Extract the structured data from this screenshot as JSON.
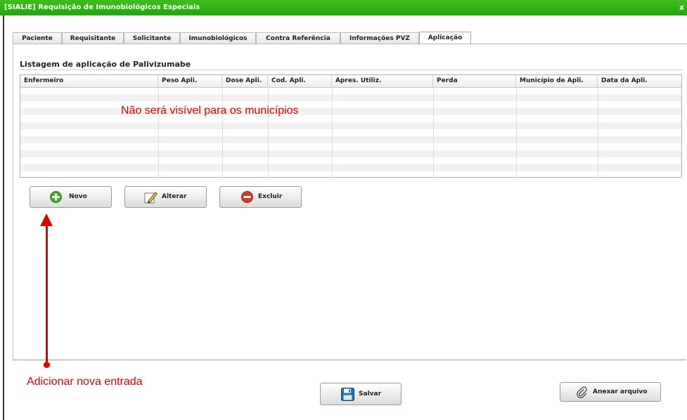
{
  "window": {
    "title": "[SIALIE] Requisição de Imunobiológicos Especiais",
    "close_symbol": "x"
  },
  "tabs": [
    {
      "label": "Paciente",
      "active": false
    },
    {
      "label": "Requisitante",
      "active": false
    },
    {
      "label": "Solicitante",
      "active": false
    },
    {
      "label": "Imunobiológicos",
      "active": false
    },
    {
      "label": "Contra Referência",
      "active": false
    },
    {
      "label": "Informações PVZ",
      "active": false
    },
    {
      "label": "Aplicação",
      "active": true
    }
  ],
  "section": {
    "title": "Listagem de aplicação de Palivizumabe"
  },
  "table": {
    "columns": [
      "Enfermeiro",
      "Peso Apli.",
      "Dose Apli.",
      "Cod. Apli.",
      "Apres. Utiliz.",
      "Perda",
      "Município de Apli.",
      "Data da Apli."
    ],
    "rows": []
  },
  "annotations": {
    "table_note": "Não será visível para os municípios",
    "new_entry_note": "Adicionar nova entrada",
    "color": "#e00000"
  },
  "buttons": {
    "novo": "Novo",
    "alterar": "Alterar",
    "excluir": "Excluir",
    "salvar": "Salvar",
    "anexar": "Anexar arquivo"
  },
  "icons": {
    "novo": "plus-circle-icon",
    "alterar": "pencil-edit-icon",
    "excluir": "minus-circle-icon",
    "salvar": "floppy-disk-icon",
    "anexar": "paperclip-icon"
  },
  "colors": {
    "titlebar": "#2aa612",
    "novo_icon": "#3fae2a",
    "excluir_icon": "#d83a2a",
    "salvar_icon": "#1f6fb8"
  }
}
